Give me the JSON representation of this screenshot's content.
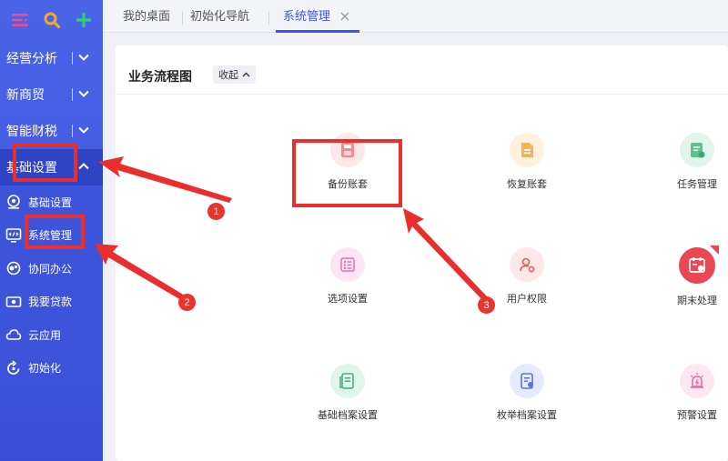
{
  "sidebar": {
    "menus": [
      {
        "label": "经营分析"
      },
      {
        "label": "新商贸"
      },
      {
        "label": "智能财税"
      },
      {
        "label": "基础设置"
      }
    ],
    "sub_items": [
      {
        "label": "基础设置",
        "icon": "settings-icon"
      },
      {
        "label": "系统管理",
        "icon": "code-monitor-icon"
      },
      {
        "label": "协同办公",
        "icon": "collaboration-icon"
      },
      {
        "label": "我要贷款",
        "icon": "loan-icon"
      },
      {
        "label": "云应用",
        "icon": "cloud-icon"
      },
      {
        "label": "初始化",
        "icon": "refresh-icon"
      }
    ]
  },
  "tabs": [
    {
      "label": "我的桌面"
    },
    {
      "label": "初始化导航"
    },
    {
      "label": "系统管理"
    }
  ],
  "panel": {
    "title": "业务流程图",
    "collapse_label": "收起"
  },
  "functions": [
    {
      "label": "备份账套",
      "icon": "backup-icon"
    },
    {
      "label": "恢复账套",
      "icon": "restore-icon"
    },
    {
      "label": "任务管理",
      "icon": "task-icon"
    },
    {
      "label": "选项设置",
      "icon": "options-icon"
    },
    {
      "label": "用户权限",
      "icon": "user-permission-icon"
    },
    {
      "label": "期末处理",
      "icon": "period-end-icon"
    },
    {
      "label": "基础档案设置",
      "icon": "base-archive-icon"
    },
    {
      "label": "枚举档案设置",
      "icon": "enum-archive-icon"
    },
    {
      "label": "预警设置",
      "icon": "alarm-icon"
    }
  ],
  "annotations": {
    "badges": [
      "1",
      "2",
      "3"
    ]
  },
  "colors": {
    "sidebar": "#4a64e8",
    "accent": "#3b55e6",
    "annotation_red": "#ea2e2e"
  }
}
